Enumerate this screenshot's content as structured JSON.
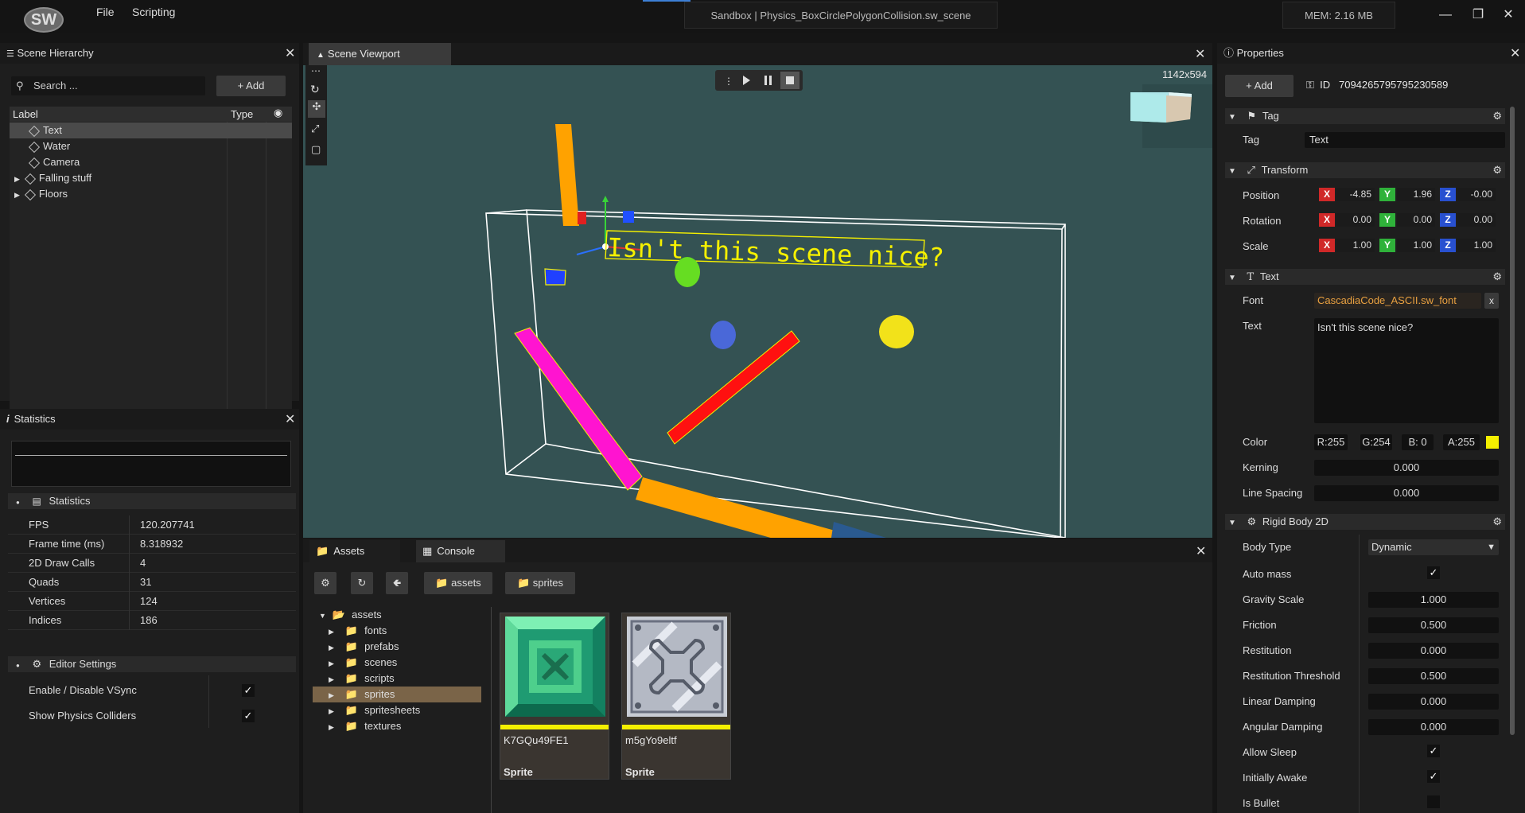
{
  "app": {
    "logo": "SW",
    "menu": [
      "File",
      "Scripting"
    ],
    "title": "Sandbox  |  Physics_BoxCirclePolygonCollision.sw_scene",
    "memory": "MEM: 2.16 MB"
  },
  "hierarchy": {
    "title": "Scene Hierarchy",
    "search_placeholder": "Search ...",
    "add_label": "Add",
    "col_label": "Label",
    "col_type": "Type",
    "items": [
      {
        "label": "Text",
        "expandable": false,
        "selected": true
      },
      {
        "label": "Water",
        "expandable": false
      },
      {
        "label": "Camera",
        "expandable": false
      },
      {
        "label": "Falling stuff",
        "expandable": true
      },
      {
        "label": "Floors",
        "expandable": true
      }
    ]
  },
  "statistics": {
    "title": "Statistics",
    "section": "Statistics",
    "rows": [
      {
        "label": "FPS",
        "value": "120.207741"
      },
      {
        "label": "Frame time (ms)",
        "value": "8.318932"
      },
      {
        "label": "2D Draw Calls",
        "value": "4"
      },
      {
        "label": "Quads",
        "value": "31"
      },
      {
        "label": "Vertices",
        "value": "124"
      },
      {
        "label": "Indices",
        "value": "186"
      }
    ],
    "editor_section": "Editor Settings",
    "settings": [
      {
        "label": "Enable / Disable VSync",
        "checked": true
      },
      {
        "label": "Show Physics Colliders",
        "checked": true
      }
    ]
  },
  "viewport": {
    "tab": "Scene Viewport",
    "resolution": "1142x594",
    "scene_text": "Isn't this scene nice?"
  },
  "bottom": {
    "tabs": [
      "Assets",
      "Console"
    ],
    "breadcrumb": [
      "assets",
      "sprites"
    ],
    "tree_root": "assets",
    "folders": [
      "fonts",
      "prefabs",
      "scenes",
      "scripts",
      "sprites",
      "spritesheets",
      "textures"
    ],
    "selected_folder": "sprites",
    "files": [
      {
        "name": "K7GQu49FE1",
        "type": "Sprite"
      },
      {
        "name": "m5gYo9eltf",
        "type": "Sprite"
      }
    ]
  },
  "properties": {
    "title": "Properties",
    "add_label": "Add",
    "id_label": "ID",
    "id_value": "7094265795795230589",
    "tag": {
      "header": "Tag",
      "label": "Tag",
      "value": "Text"
    },
    "transform": {
      "header": "Transform",
      "rows": [
        {
          "label": "Position",
          "x": "-4.85",
          "y": "1.96",
          "z": "-0.00"
        },
        {
          "label": "Rotation",
          "x": "0.00",
          "y": "0.00",
          "z": "0.00"
        },
        {
          "label": "Scale",
          "x": "1.00",
          "y": "1.00",
          "z": "1.00"
        }
      ]
    },
    "text": {
      "header": "Text",
      "font_label": "Font",
      "font_value": "CascadiaCode_ASCII.sw_font",
      "font_clear": "x",
      "text_label": "Text",
      "text_value": "Isn't this scene nice?",
      "color_label": "Color",
      "r": "R:255",
      "g": "G:254",
      "b": "B: 0",
      "a": "A:255",
      "swatch": "#f5f000",
      "kerning_label": "Kerning",
      "kerning": "0.000",
      "spacing_label": "Line Spacing",
      "spacing": "0.000"
    },
    "rigidbody": {
      "header": "Rigid Body 2D",
      "body_type_label": "Body Type",
      "body_type": "Dynamic",
      "rows": [
        {
          "label": "Auto mass",
          "check": true
        },
        {
          "label": "Gravity Scale",
          "value": "1.000"
        },
        {
          "label": "Friction",
          "value": "0.500"
        },
        {
          "label": "Restitution",
          "value": "0.000"
        },
        {
          "label": "Restitution Threshold",
          "value": "0.500"
        },
        {
          "label": "Linear Damping",
          "value": "0.000"
        },
        {
          "label": "Angular Damping",
          "value": "0.000"
        },
        {
          "label": "Allow Sleep",
          "check": true
        },
        {
          "label": "Initially Awake",
          "check": true
        },
        {
          "label": "Is Bullet",
          "check": false
        }
      ]
    }
  }
}
